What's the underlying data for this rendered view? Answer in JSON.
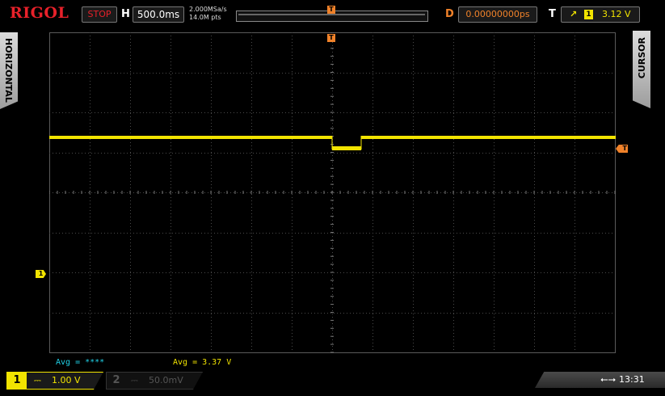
{
  "header": {
    "brand": "RIGOL",
    "run_status": "STOP",
    "horizontal_label": "H",
    "timebase": "500.0ms",
    "sample_rate": "2.000MSa/s",
    "memory_depth": "14.0M pts",
    "delay_label": "D",
    "delay": "0.00000000ps",
    "trigger_label": "T",
    "trigger_source": "1",
    "trigger_level": "3.12 V",
    "trigger_marker": "T"
  },
  "side_tabs": {
    "left": "HORIZONTAL",
    "right": "CURSOR"
  },
  "screen": {
    "ch1_marker": "1",
    "trigger_level_marker": "T",
    "trigger_position_marker": "T"
  },
  "measurements": {
    "ch1_avg": "Avg = ****",
    "ch2_avg": "Avg = 3.37 V"
  },
  "channels": [
    {
      "number": "1",
      "coupling_icon": "DC",
      "scale": "1.00 V",
      "active": true,
      "color": "#f2e400"
    },
    {
      "number": "2",
      "coupling_icon": "DC",
      "scale": "50.0mV",
      "active": false,
      "color": "#555555"
    }
  ],
  "status_bar": {
    "usb_icon": "usb-icon",
    "time": "13:31"
  },
  "colors": {
    "ch1": "#f2e400",
    "trigger": "#f0822a",
    "brand": "#e8212a",
    "measure_ch1": "#1fd2e8"
  }
}
